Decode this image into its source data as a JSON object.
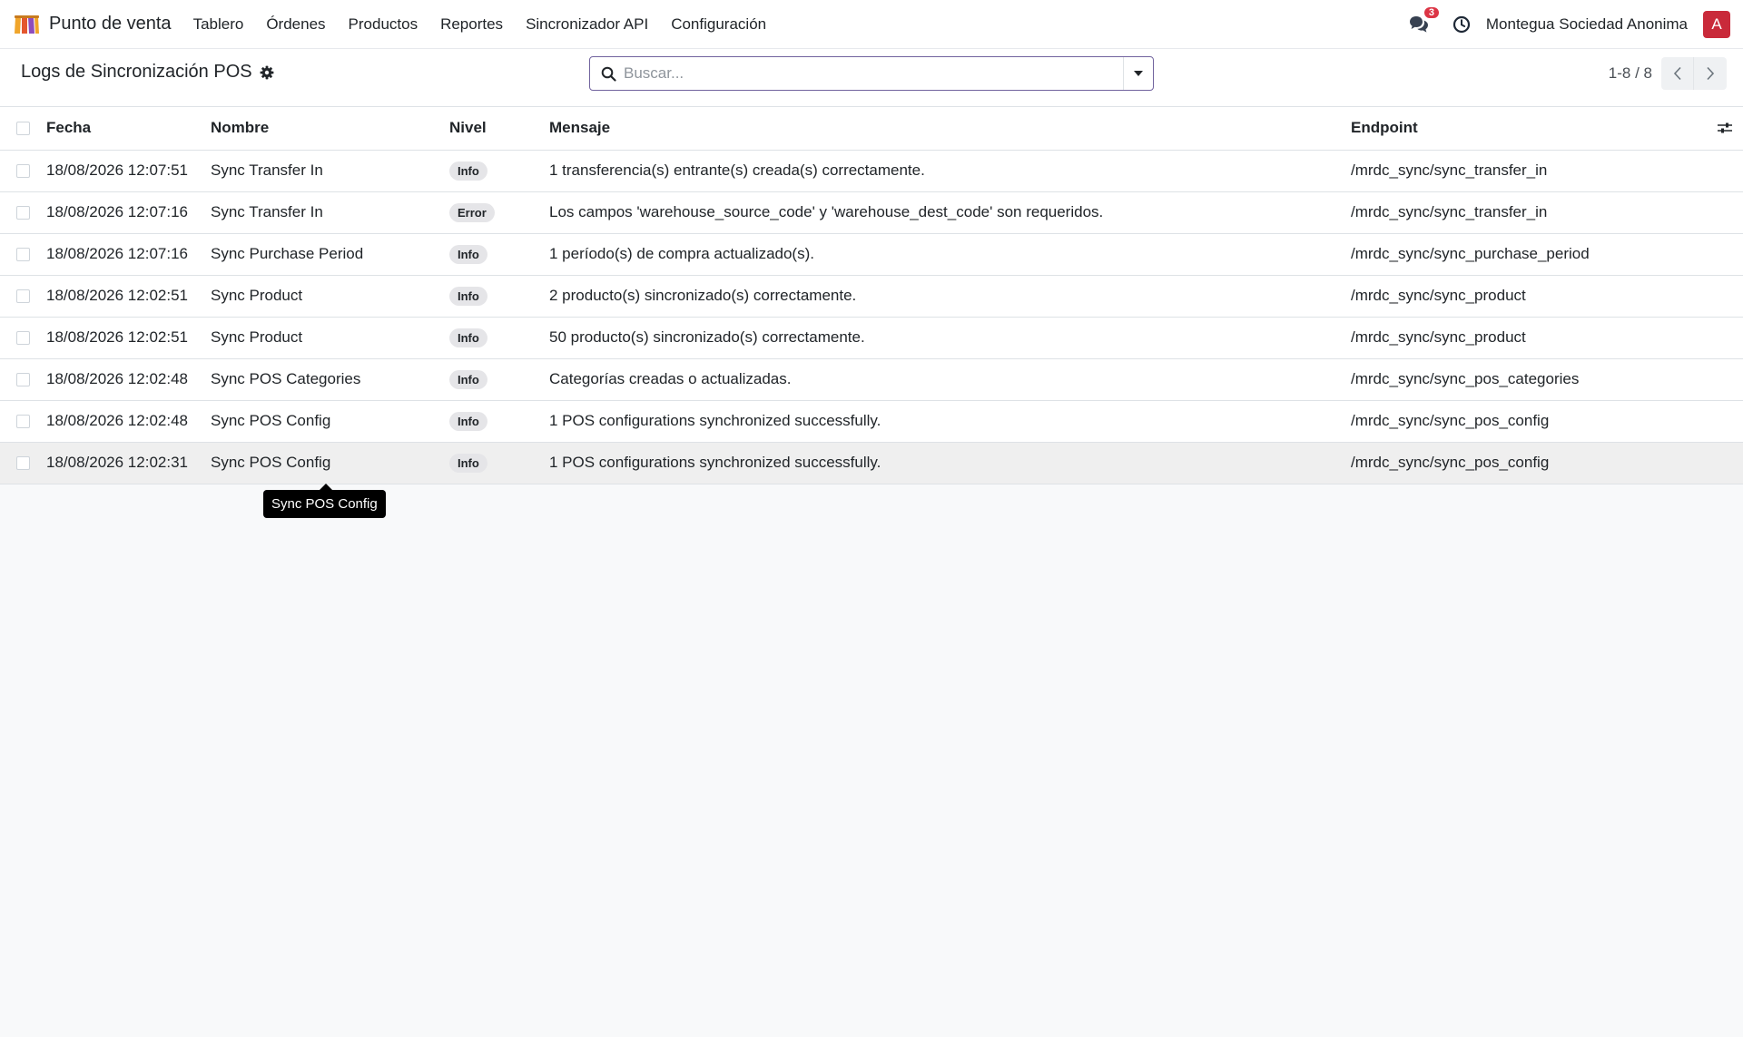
{
  "app": {
    "name": "Punto de venta",
    "menu": [
      "Tablero",
      "Órdenes",
      "Productos",
      "Reportes",
      "Sincronizador API",
      "Configuración"
    ]
  },
  "systray": {
    "message_count": "3",
    "company": "Montegua Sociedad Anonima",
    "avatar_letter": "A",
    "avatar_color": "#c92a3a"
  },
  "control_panel": {
    "title": "Logs de Sincronización POS",
    "search_placeholder": "Buscar...",
    "pager": "1-8 / 8"
  },
  "table": {
    "columns": {
      "fecha": "Fecha",
      "nombre": "Nombre",
      "nivel": "Nivel",
      "mensaje": "Mensaje",
      "endpoint": "Endpoint"
    },
    "rows": [
      {
        "fecha": "18/08/2026 12:07:51",
        "nombre": "Sync Transfer In",
        "nivel": "Info",
        "mensaje": "1 transferencia(s) entrante(s) creada(s) correctamente.",
        "endpoint": "/mrdc_sync/sync_transfer_in"
      },
      {
        "fecha": "18/08/2026 12:07:16",
        "nombre": "Sync Transfer In",
        "nivel": "Error",
        "mensaje": "Los campos 'warehouse_source_code' y 'warehouse_dest_code' son requeridos.",
        "endpoint": "/mrdc_sync/sync_transfer_in"
      },
      {
        "fecha": "18/08/2026 12:07:16",
        "nombre": "Sync Purchase Period",
        "nivel": "Info",
        "mensaje": "1 período(s) de compra actualizado(s).",
        "endpoint": "/mrdc_sync/sync_purchase_period"
      },
      {
        "fecha": "18/08/2026 12:02:51",
        "nombre": "Sync Product",
        "nivel": "Info",
        "mensaje": "2 producto(s) sincronizado(s) correctamente.",
        "endpoint": "/mrdc_sync/sync_product"
      },
      {
        "fecha": "18/08/2026 12:02:51",
        "nombre": "Sync Product",
        "nivel": "Info",
        "mensaje": "50 producto(s) sincronizado(s) correctamente.",
        "endpoint": "/mrdc_sync/sync_product"
      },
      {
        "fecha": "18/08/2026 12:02:48",
        "nombre": "Sync POS Categories",
        "nivel": "Info",
        "mensaje": "Categorías creadas o actualizadas.",
        "endpoint": "/mrdc_sync/sync_pos_categories"
      },
      {
        "fecha": "18/08/2026 12:02:48",
        "nombre": "Sync POS Config",
        "nivel": "Info",
        "mensaje": "1 POS configurations synchronized successfully.",
        "endpoint": "/mrdc_sync/sync_pos_config"
      },
      {
        "fecha": "18/08/2026 12:02:31",
        "nombre": "Sync POS Config",
        "nivel": "Info",
        "mensaje": "1 POS configurations synchronized successfully.",
        "endpoint": "/mrdc_sync/sync_pos_config"
      }
    ]
  },
  "tooltip": {
    "text": "Sync POS Config"
  }
}
